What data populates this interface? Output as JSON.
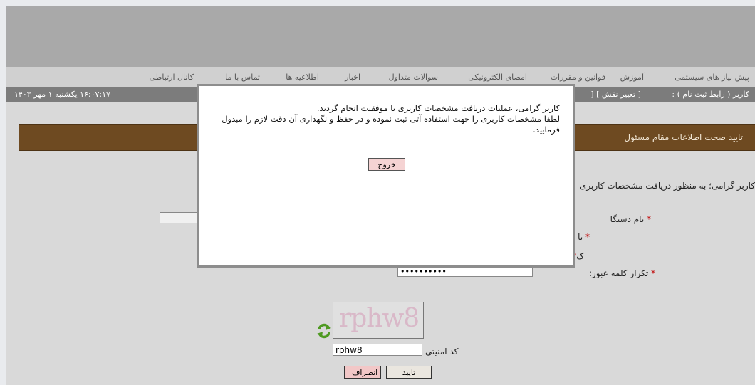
{
  "menu": {
    "items": [
      "پیش نیاز های سیستمی",
      "آموزش",
      "قوانین و مقررات",
      "امضای الکترونیکی",
      "سوالات متداول",
      "اخبار",
      "اطلاعیه ها",
      "تماس با ما",
      "کانال ارتباطی"
    ]
  },
  "infobar": {
    "user_text": "کاربر ( رابط ثبت نام ) :",
    "change_role": "[ تغییر نقش ] [",
    "datetime": "۱۶:۰۷:۱۷  یکشنبه ۱ مهر ۱۴۰۳"
  },
  "page": {
    "title": "تایید صحت اطلاعات مقام مسئول",
    "intro": "کاربر گرامی؛ به منظور دریافت مشخصات کاربری",
    "field_org_label": "نام دستگا",
    "field_name_label": "نا",
    "field_pass_label": "ک",
    "field_confirm_label": "تکرار کلمه عبور:",
    "confirm_value": "••••••••••",
    "captcha_image_text": "rphw8",
    "captcha_label": "کد امنیتی",
    "captcha_value": "rphw8",
    "confirm_button": "تایید",
    "cancel_button": "انصراف"
  },
  "modal": {
    "line1": "کاربر گرامی، عملیات دریافت مشخصات کاربری با موفقیت انجام گردید.",
    "line2": "لطفا مشخصات کاربری را جهت استفاده آتی ثبت نموده و در حفظ و نگهداری آن دقت لازم را مبذول فرمایید.",
    "exit_button": "خروج"
  },
  "colors": {
    "title_bar": "#6e4a21",
    "required": "#c00000",
    "modal_button": "#f5d3d3",
    "refresh_icon": "#4f9a22"
  }
}
